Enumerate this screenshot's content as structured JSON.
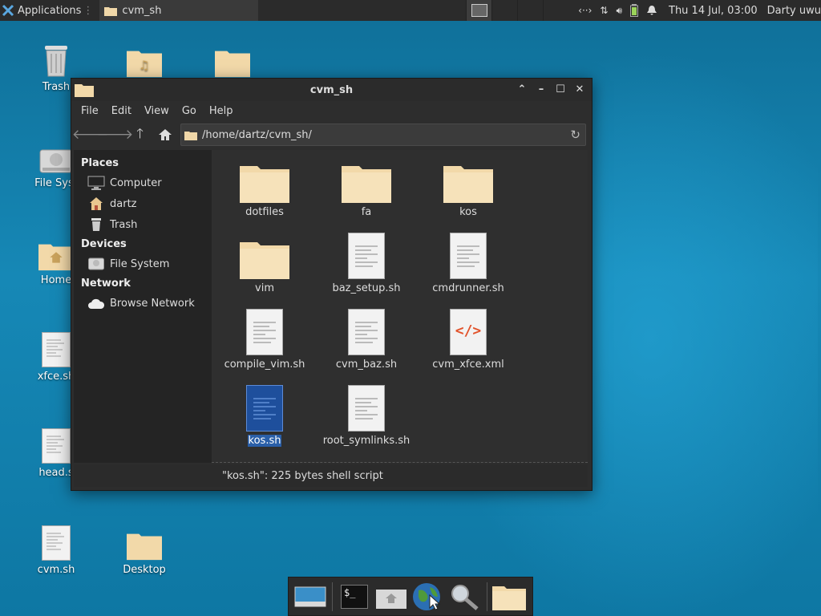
{
  "panel": {
    "applications_label": "Applications",
    "task_title": "cvm_sh",
    "clock": "Thu 14 Jul, 03:00",
    "user": "Darty uwu",
    "network_glyph": "‹··›"
  },
  "desktop": {
    "icons": {
      "trash": "Trash",
      "filesystem": "File Syst",
      "home": "Home",
      "xfce": "xfce.sh",
      "head": "head.s",
      "cvm": "cvm.sh",
      "desktop": "Desktop"
    }
  },
  "window": {
    "title": "cvm_sh",
    "menu": [
      "File",
      "Edit",
      "View",
      "Go",
      "Help"
    ],
    "path": "/home/dartz/cvm_sh/",
    "sidebar": {
      "places_header": "Places",
      "places": [
        "Computer",
        "dartz",
        "Trash"
      ],
      "devices_header": "Devices",
      "devices": [
        "File System"
      ],
      "network_header": "Network",
      "network": [
        "Browse Network"
      ]
    },
    "files": [
      "dotfiles",
      "fa",
      "kos",
      "vim",
      "baz_setup.sh",
      "cmdrunner.sh",
      "compile_vim.sh",
      "cvm_baz.sh",
      "cvm_xfce.xml",
      "kos.sh",
      "root_symlinks.sh"
    ],
    "xml_glyph": "</>",
    "status": "\"kos.sh\": 225 bytes shell script"
  },
  "dock": {
    "terminal_glyph": "$_"
  }
}
